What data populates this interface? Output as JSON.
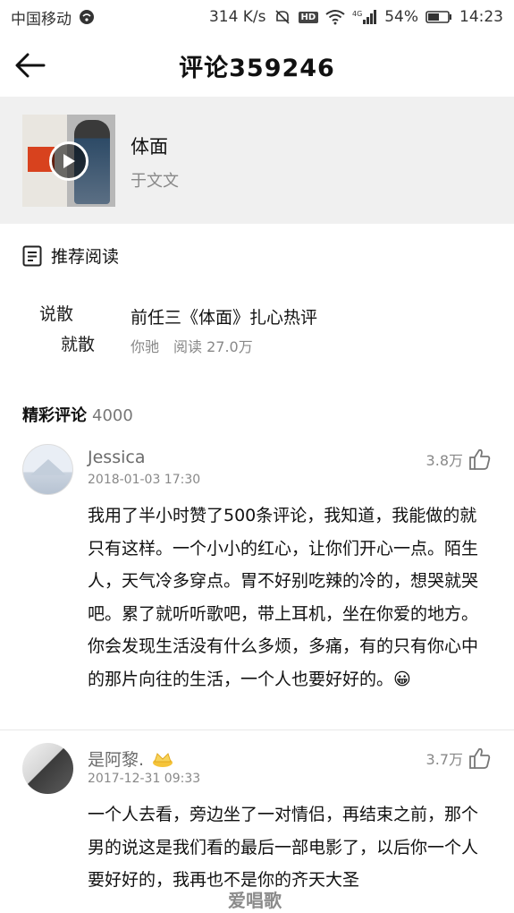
{
  "status_bar": {
    "carrier": "中国移动",
    "net_speed": "314 K/s",
    "hd": "HD",
    "signal_label": "4G",
    "battery": "54%",
    "time": "14:23"
  },
  "header": {
    "title": "评论359246"
  },
  "song": {
    "title": "体面",
    "artist": "于文文"
  },
  "recommend": {
    "title": "推荐阅读",
    "thumb_line1": "说散",
    "thumb_line2": "就散",
    "item_title": "前任三《体面》扎心热评",
    "item_author": "你驰",
    "item_reads": "阅读 27.0万"
  },
  "comments_section": {
    "label": "精彩评论",
    "count": "4000"
  },
  "comments": [
    {
      "author": "Jessica",
      "date": "2018-01-03 17:30",
      "likes": "3.8万",
      "text": "我用了半小时赞了500条评论，我知道，我能做的就只有这样。一个小小的红心，让你们开心一点。陌生人，天气冷多穿点。胃不好别吃辣的冷的，想哭就哭吧。累了就听听歌吧，带上耳机，坐在你爱的地方。你会发现生活没有什么多烦，多痛，有的只有你心中的那片向往的生活，一个人也要好好的。😀"
    },
    {
      "author": "是阿黎.",
      "date": "2017-12-31 09:33",
      "likes": "3.7万",
      "text": "一个人去看，旁边坐了一对情侣，再结束之前，那个男的说这是我们看的最后一部电影了，以后你一个人要好好的，我再也不是你的齐天大圣"
    }
  ],
  "watermark": "爱唱歌",
  "colors": {
    "card_bg": "#f0f0f0",
    "muted_text": "#888888"
  }
}
